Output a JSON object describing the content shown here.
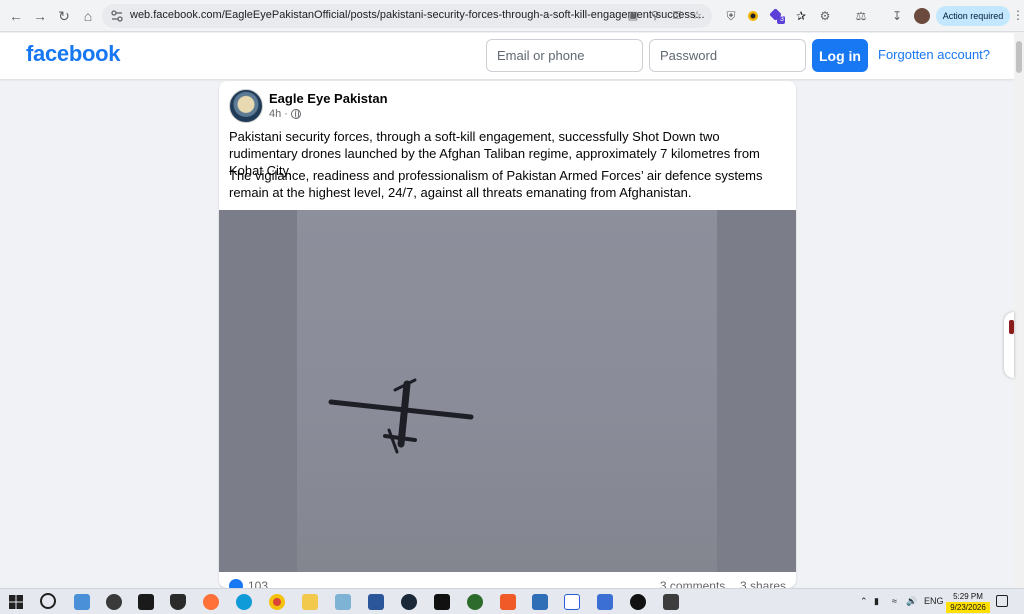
{
  "browser": {
    "url": "web.facebook.com/EagleEyePakistanOfficial/posts/pakistani-security-forces-through-a-soft-kill-engagement-success...",
    "action_label": "Action required",
    "extension_badge": "3"
  },
  "facebook": {
    "logo": "facebook",
    "email_placeholder": "Email or phone",
    "password_placeholder": "Password",
    "login_label": "Log in",
    "forgot_label": "Forgotten account?"
  },
  "post": {
    "page_name": "Eagle Eye Pakistan",
    "time": "4h",
    "separator": "·",
    "paragraphs": [
      "Pakistani security forces, through a soft-kill engagement, successfully Shot Down two rudimentary drones launched by the Afghan Taliban regime, approximately 7 kilometres from Kohat City.",
      "The vigilance, readiness and professionalism of Pakistan Armed Forces’ air defence systems remain at the highest level, 24/7, against all threats emanating from Afghanistan."
    ],
    "reaction_count": "103",
    "comments": "3 comments",
    "shares": "3 shares"
  },
  "taskbar": {
    "language": "ENG",
    "time": "5:29 PM",
    "date": "9/23/2026"
  },
  "colors": {
    "brand": "#1877f2",
    "page_bg": "#f0f2f5"
  }
}
